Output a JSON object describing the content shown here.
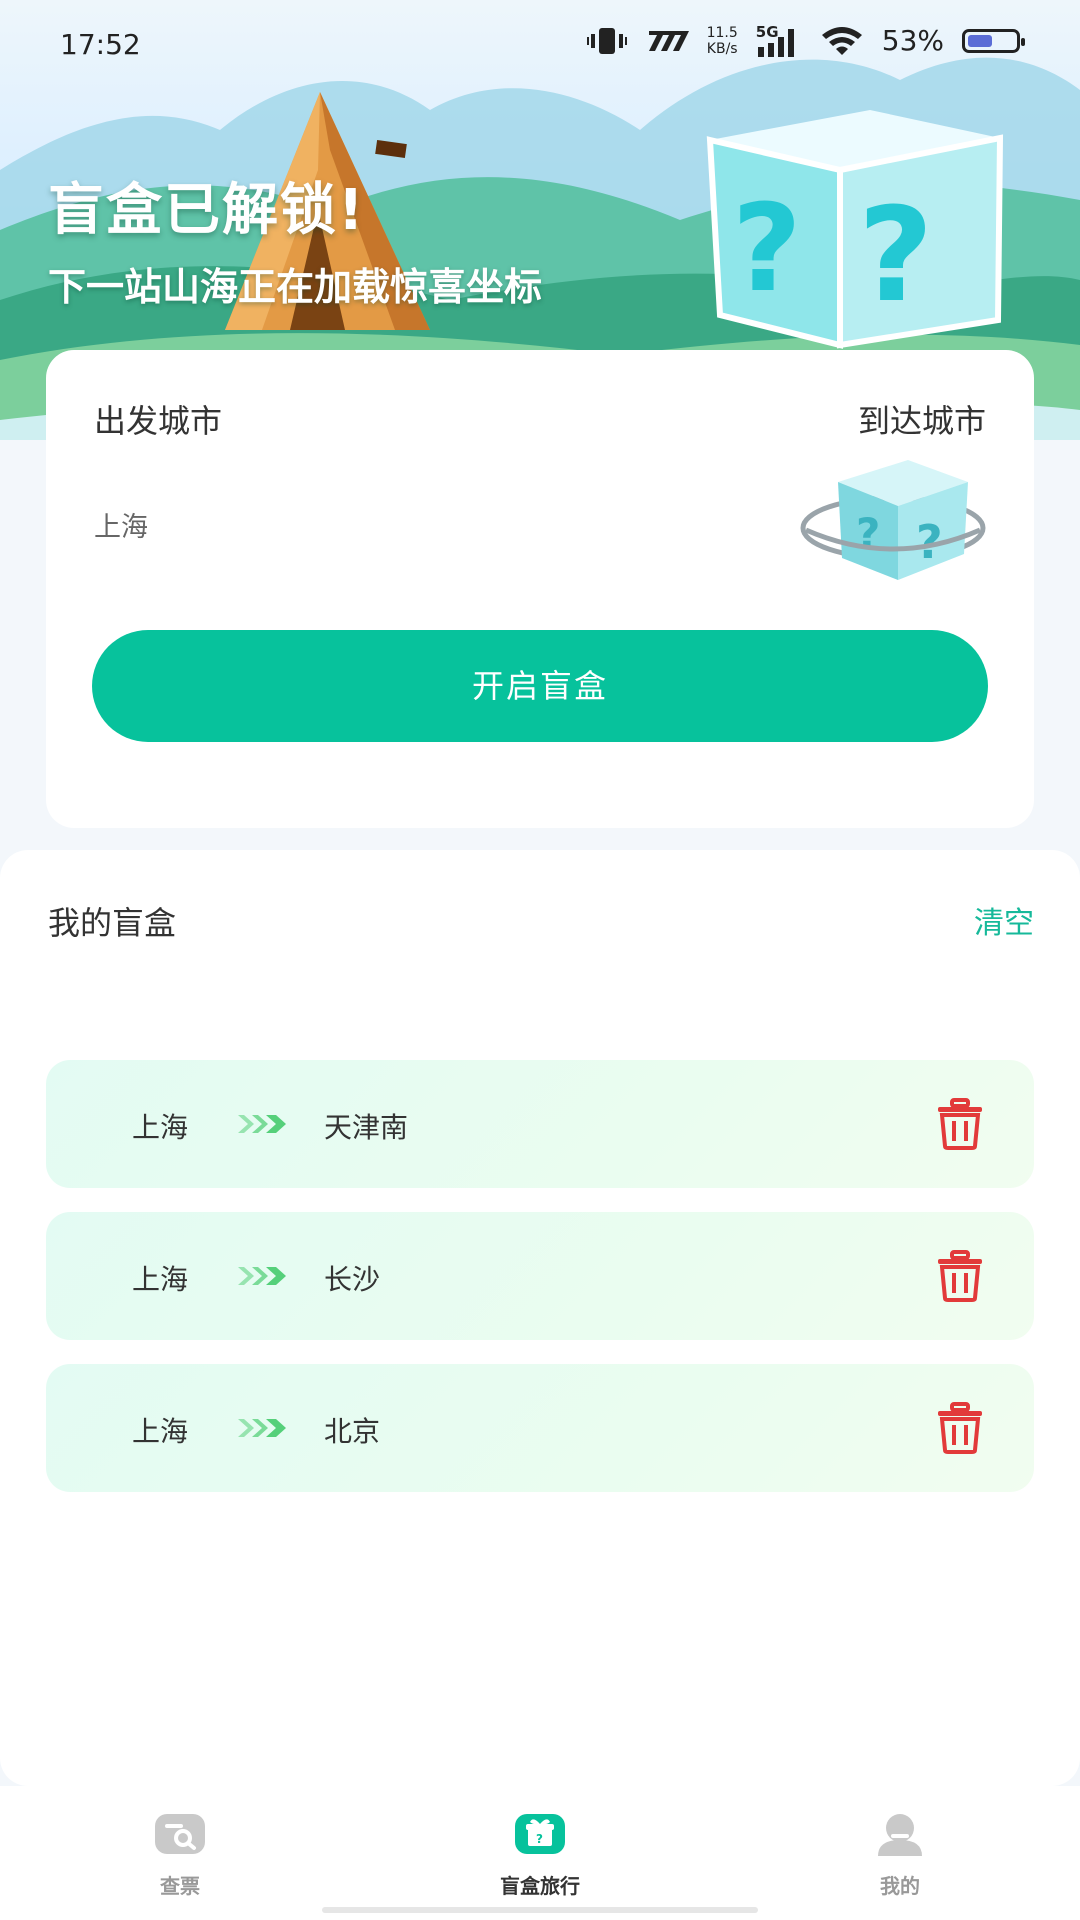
{
  "status_bar": {
    "time": "17:52",
    "net_speed": "11.5",
    "net_unit": "KB/s",
    "network": "5G",
    "battery": "53%",
    "battery_level": 0.53
  },
  "hero": {
    "title": "盲盒已解锁!",
    "subtitle": "下一站山海正在加载惊喜坐标"
  },
  "search_card": {
    "from_label": "出发城市",
    "to_label": "到达城市",
    "from_city": "上海",
    "open_button": "开启盲盒"
  },
  "my_boxes": {
    "title": "我的盲盒",
    "clear": "清空",
    "items": [
      {
        "from": "上海",
        "to": "天津南"
      },
      {
        "from": "上海",
        "to": "长沙"
      },
      {
        "from": "上海",
        "to": "北京"
      }
    ]
  },
  "bottom_nav": {
    "items": [
      {
        "label": "查票",
        "icon": "ticket-search-icon"
      },
      {
        "label": "盲盒旅行",
        "icon": "gift-box-icon"
      },
      {
        "label": "我的",
        "icon": "profile-icon"
      }
    ],
    "active": 1
  },
  "colors": {
    "accent": "#07c29c",
    "delete": "#e23a3a",
    "arrow": "#55d07a"
  }
}
